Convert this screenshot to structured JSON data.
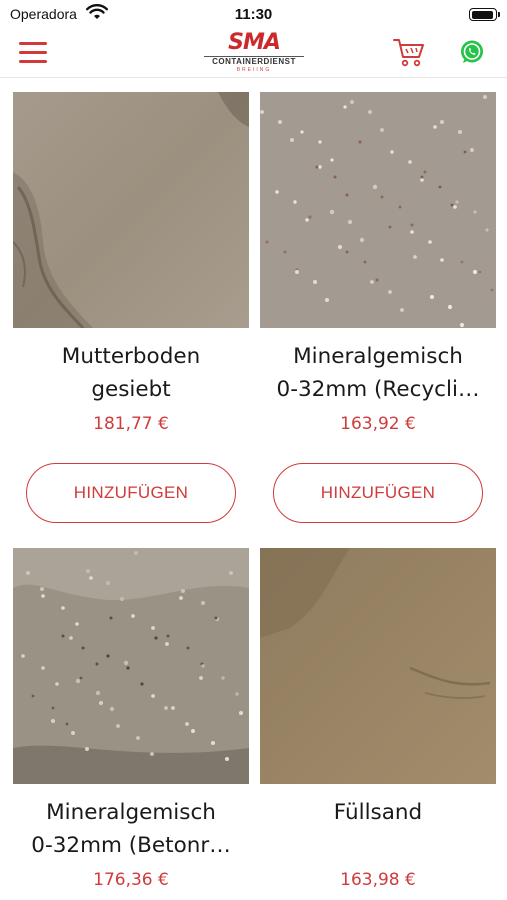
{
  "status_bar": {
    "carrier": "Operadora",
    "time": "11:30"
  },
  "header": {
    "logo_text": "SMA",
    "logo_subtitle": "CONTAINERDIENST",
    "logo_subtitle2": "BREIING",
    "icons": [
      "menu-icon",
      "cart-icon",
      "whatsapp-icon"
    ],
    "accent_color": "#d03b3b"
  },
  "products": [
    {
      "title_line1": "Mutterboden",
      "title_line2": "gesiebt",
      "price": "181,77 €",
      "button": "HINZUFÜGEN"
    },
    {
      "title_line1": "Mineralgemisch",
      "title_line2": "0-32mm (Recycli…",
      "price": "163,92 €",
      "button": "HINZUFÜGEN"
    },
    {
      "title_line1": "Mineralgemisch",
      "title_line2": "0-32mm (Betonr…",
      "price": "176,36 €"
    },
    {
      "title_line1": "Füllsand",
      "title_line2": "",
      "price": "163,98 €"
    }
  ]
}
